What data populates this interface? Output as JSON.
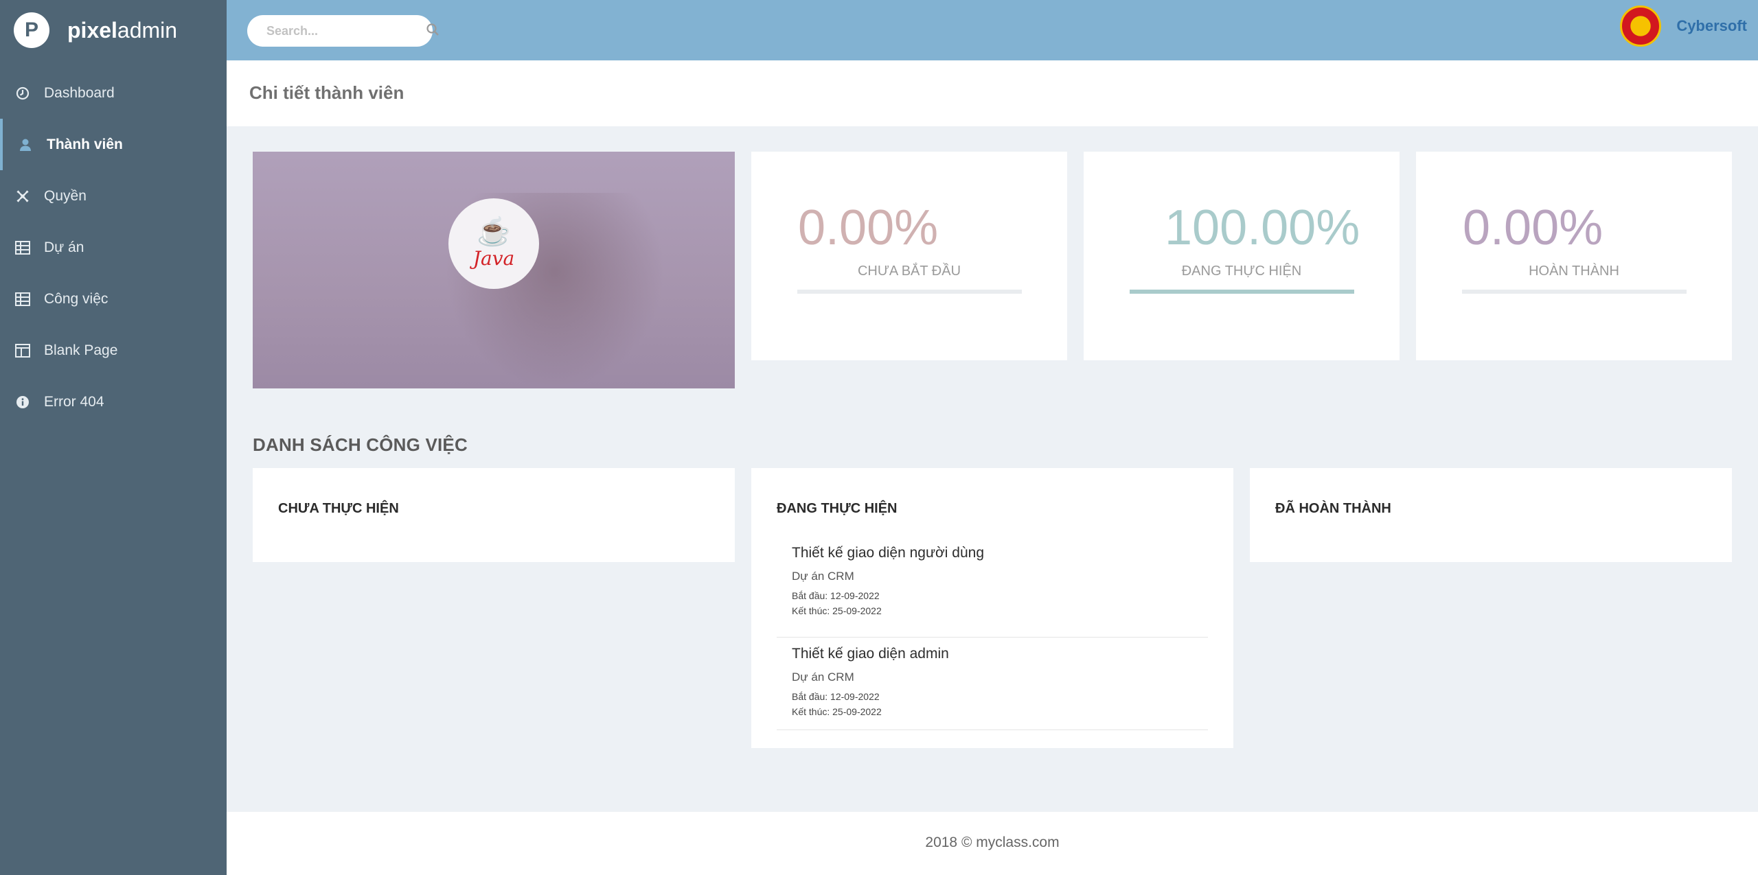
{
  "brand": {
    "logo_letter": "P",
    "name_bold": "pixel",
    "name_light": "admin"
  },
  "sidebar": {
    "items": [
      {
        "label": "Dashboard",
        "icon": "clock-icon"
      },
      {
        "label": "Thành viên",
        "icon": "user-icon",
        "active": true
      },
      {
        "label": "Quyền",
        "icon": "crop-icon"
      },
      {
        "label": "Dự án",
        "icon": "grid-icon"
      },
      {
        "label": "Công việc",
        "icon": "grid-icon"
      },
      {
        "label": "Blank Page",
        "icon": "columns-icon"
      },
      {
        "label": "Error 404",
        "icon": "info-icon"
      }
    ]
  },
  "topbar": {
    "search_placeholder": "Search...",
    "user_name": "Cybersoft"
  },
  "page": {
    "title": "Chi tiết thành viên"
  },
  "profile": {
    "badge_text": "Java"
  },
  "stats": [
    {
      "value": "0.00%",
      "label": "CHƯA BẮT ĐẦU",
      "progress": 0.0,
      "color": "#d0b1b1"
    },
    {
      "value": "100.00%",
      "label": "ĐANG THỰC HIỆN",
      "progress": 1.0,
      "color": "#a9cbcb"
    },
    {
      "value": "0.00%",
      "label": "HOÀN THÀNH",
      "progress": 0.0,
      "color": "#b9a4bf"
    }
  ],
  "tasks_section": {
    "title": "DANH SÁCH CÔNG VIỆC",
    "columns": [
      {
        "title": "CHƯA THỰC HIỆN",
        "tasks": []
      },
      {
        "title": "ĐANG THỰC HIỆN",
        "tasks": [
          {
            "name": "Thiết kế giao diện người dùng",
            "project": "Dự án CRM",
            "start": "Bắt đầu: 12-09-2022",
            "end": "Kết thúc: 25-09-2022"
          },
          {
            "name": "Thiết kế giao diện admin",
            "project": "Dự án CRM",
            "start": "Bắt đầu: 12-09-2022",
            "end": "Kết thúc: 25-09-2022"
          }
        ]
      },
      {
        "title": "ĐÃ HOÀN THÀNH",
        "tasks": []
      }
    ]
  },
  "footer": {
    "text": "2018 © myclass.com"
  }
}
